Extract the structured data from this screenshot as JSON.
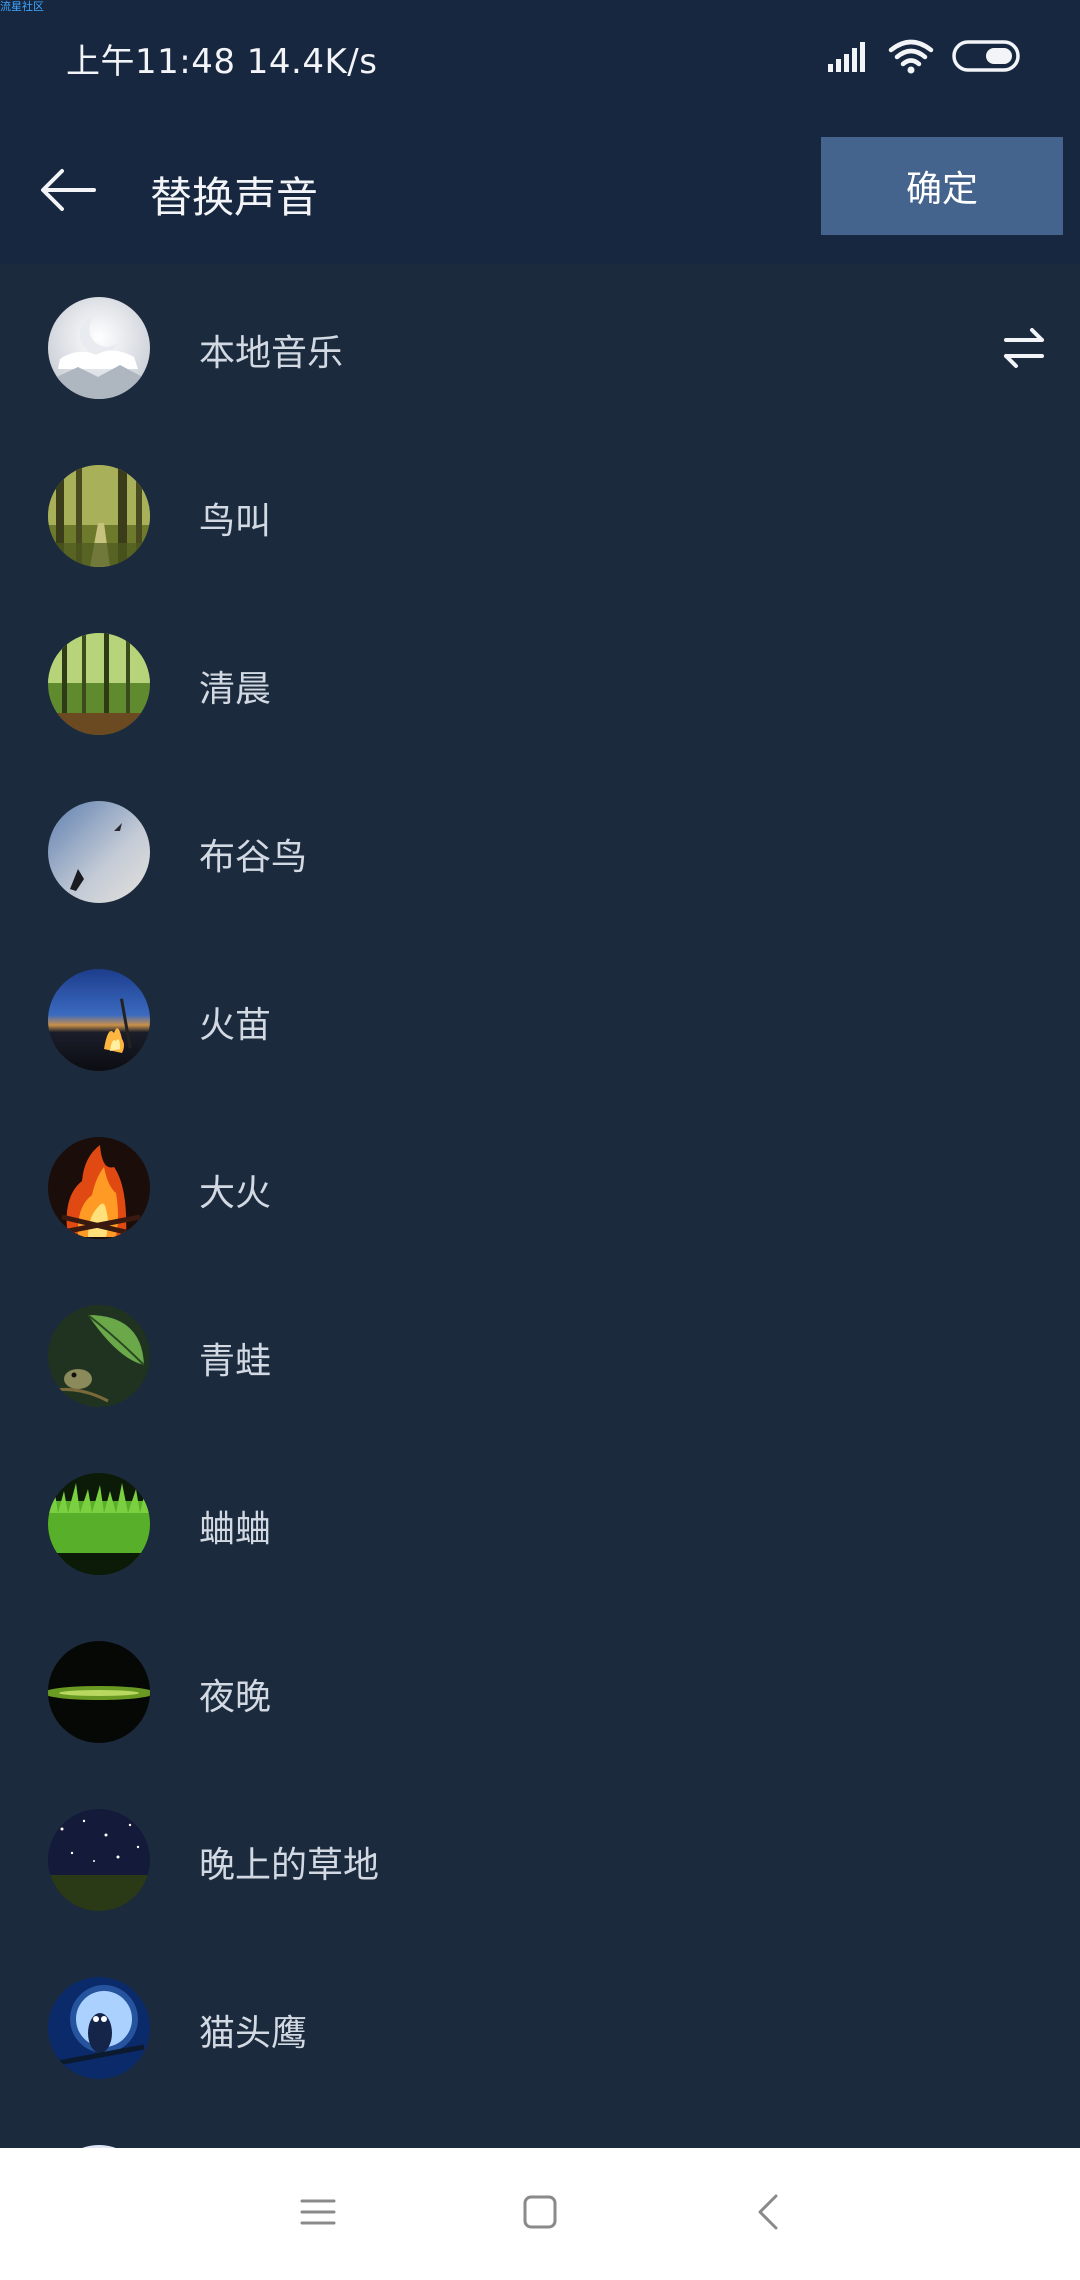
{
  "watermark": "流星社区",
  "status_bar": {
    "time_speed": "上午11:48 14.4K/s",
    "icons": [
      "signal-icon",
      "wifi-icon",
      "battery-icon"
    ]
  },
  "header": {
    "title": "替换声音",
    "confirm_label": "确定",
    "back_icon": "arrow-left-icon"
  },
  "sounds": [
    {
      "label": "本地音乐",
      "thumb": "moon-cloud",
      "has_swap": true
    },
    {
      "label": "鸟叫",
      "thumb": "forest-path"
    },
    {
      "label": "清晨",
      "thumb": "morning-forest"
    },
    {
      "label": "布谷鸟",
      "thumb": "bird-sky"
    },
    {
      "label": "火苗",
      "thumb": "campfire-dusk"
    },
    {
      "label": "大火",
      "thumb": "bonfire"
    },
    {
      "label": "青蛙",
      "thumb": "frog-leaf"
    },
    {
      "label": "蛐蛐",
      "thumb": "grass"
    },
    {
      "label": "夜晚",
      "thumb": "night-horizon"
    },
    {
      "label": "晚上的草地",
      "thumb": "starry-grass"
    },
    {
      "label": "猫头鹰",
      "thumb": "owl-moon"
    }
  ],
  "nav_bar": {
    "icons": [
      "menu-icon",
      "home-icon",
      "back-icon"
    ]
  },
  "colors": {
    "background": "#1b2a3d",
    "header": "#172740",
    "accent_button": "#44648d",
    "nav_bar": "#ffffff"
  }
}
